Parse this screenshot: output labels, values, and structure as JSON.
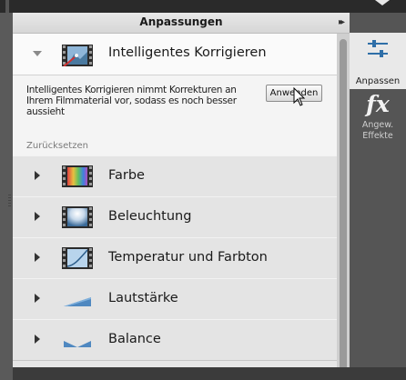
{
  "panel": {
    "title": "Anpassungen",
    "collapse_icon": "double-chevron-right-icon"
  },
  "expanded_section": {
    "label": "Intelligentes Korrigieren",
    "description": "Intelligentes Korrigieren nimmt Korrekturen an Ihrem Filmmaterial vor, sodass es noch besser aussieht",
    "apply_label": "Anwenden",
    "reset_label": "Zurücksetzen",
    "icon": "smart-fix-icon"
  },
  "sections": [
    {
      "label": "Farbe",
      "icon": "color-filmstrip-icon"
    },
    {
      "label": "Beleuchtung",
      "icon": "lighting-filmstrip-icon"
    },
    {
      "label": "Temperatur und Farbton",
      "icon": "temperature-filmstrip-icon"
    },
    {
      "label": "Lautstärke",
      "icon": "volume-ramp-icon"
    },
    {
      "label": "Balance",
      "icon": "balance-icon"
    }
  ],
  "sidebar": {
    "adjust_label": "Anpassen",
    "effects_icon": "fx",
    "effects_label": "Angew. Effekte"
  },
  "colors": {
    "panel_bg": "#e4e4e4",
    "sidebar_bg": "#555555",
    "active_tool_bg": "#e9e9e9"
  }
}
